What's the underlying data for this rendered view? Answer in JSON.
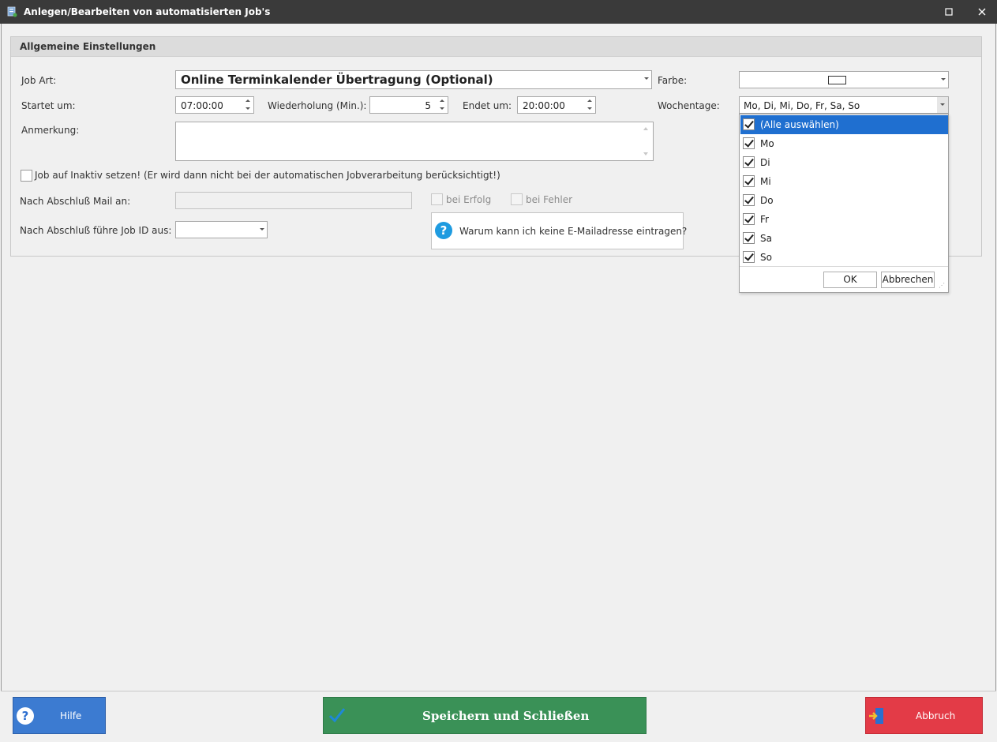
{
  "window": {
    "title": "Anlegen/Bearbeiten von automatisierten Job's"
  },
  "group": {
    "header": "Allgemeine Einstellungen"
  },
  "form": {
    "job_art_label": "Job Art:",
    "job_art_value": "Online Terminkalender Übertragung (Optional)",
    "farbe_label": "Farbe:",
    "startet_label": "Startet um:",
    "startet_value": "07:00:00",
    "wiederholung_label": "Wiederholung (Min.):",
    "wiederholung_value": "5",
    "endet_label": "Endet um:",
    "endet_value": "20:00:00",
    "wochentage_label": "Wochentage:",
    "wochentage_value": "Mo, Di, Mi, Do, Fr, Sa, So",
    "anmerkung_label": "Anmerkung:",
    "anmerkung_value": "",
    "inaktiv_label": "Job auf Inaktiv setzen! (Er wird dann nicht bei der automatischen Jobverarbeitung berücksichtigt!)",
    "inaktiv_checked": false,
    "mail_label": "Nach Abschluß Mail an:",
    "mail_value": "",
    "bei_erfolg_label": "bei Erfolg",
    "bei_fehler_label": "bei Fehler",
    "job_id_label": "Nach Abschluß führe Job ID aus:",
    "job_id_value": "",
    "help_text": "Warum kann ich keine E-Mailadresse eintragen?"
  },
  "weekday_dropdown": {
    "items": [
      {
        "label": "(Alle auswählen)",
        "checked": true,
        "selected": true
      },
      {
        "label": "Mo",
        "checked": true
      },
      {
        "label": "Di",
        "checked": true
      },
      {
        "label": "Mi",
        "checked": true
      },
      {
        "label": "Do",
        "checked": true
      },
      {
        "label": "Fr",
        "checked": true
      },
      {
        "label": "Sa",
        "checked": true
      },
      {
        "label": "So",
        "checked": true
      }
    ],
    "ok_label": "OK",
    "cancel_label": "Abbrechen"
  },
  "footer": {
    "hilfe_label": "Hilfe",
    "save_label": "Speichern und Schließen",
    "abbruch_label": "Abbruch"
  },
  "colors": {
    "titlebar": "#3a3a3a",
    "hilfe": "#3c7bd1",
    "save": "#3a9157",
    "abbruch": "#e33b47",
    "selection": "#1f6fd0"
  }
}
